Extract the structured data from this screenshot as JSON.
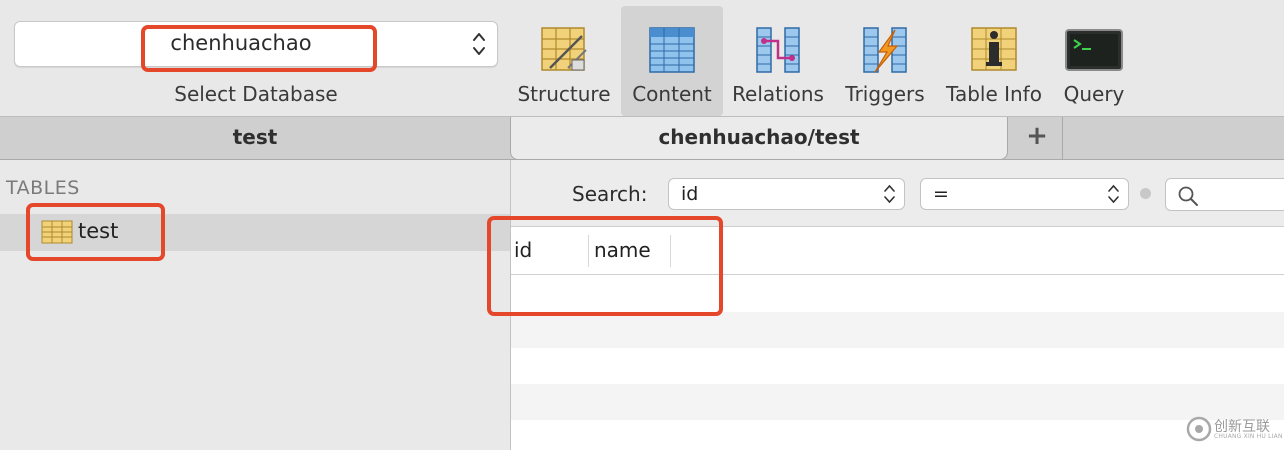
{
  "toolbar": {
    "database": {
      "selected": "chenhuachao",
      "caption": "Select Database"
    },
    "tools": [
      {
        "label": "Structure",
        "icon": "structure-icon",
        "active": false
      },
      {
        "label": "Content",
        "icon": "content-icon",
        "active": true
      },
      {
        "label": "Relations",
        "icon": "relations-icon",
        "active": false
      },
      {
        "label": "Triggers",
        "icon": "triggers-icon",
        "active": false
      },
      {
        "label": "Table Info",
        "icon": "table-info-icon",
        "active": false
      },
      {
        "label": "Query",
        "icon": "query-icon",
        "active": false
      }
    ]
  },
  "tabs": {
    "items": [
      {
        "label": "test"
      },
      {
        "label": "chenhuachao/test",
        "active": true
      }
    ],
    "add_label": "+"
  },
  "sidebar": {
    "header": "TABLES",
    "tables": [
      {
        "name": "test",
        "selected": true,
        "icon": "table-icon"
      }
    ]
  },
  "filter": {
    "label": "Search:",
    "column": "id",
    "operator": "=",
    "search_icon": "search-icon"
  },
  "grid": {
    "columns": [
      "id",
      "name"
    ],
    "rows": []
  },
  "watermark": {
    "text": "创新互联",
    "subtext": "CHUANG XIN HU LIAN"
  },
  "colors": {
    "annotation": "#e5472a",
    "active_tool_bg": "#d3d3d3"
  }
}
